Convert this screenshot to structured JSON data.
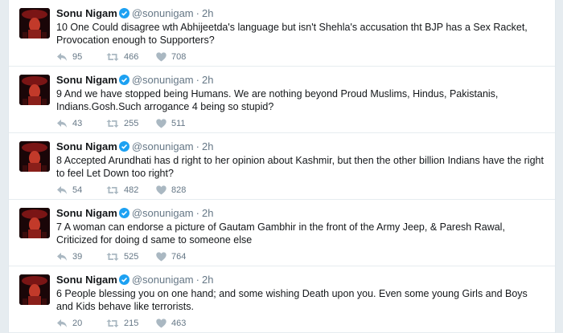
{
  "colors": {
    "verified": "#1da1f2",
    "muted": "#657786",
    "text": "#14171a",
    "background": "#e6ecf0"
  },
  "icons": {
    "reply": "reply-icon",
    "retweet": "retweet-icon",
    "like": "heart-icon",
    "verified": "verified-badge-icon"
  },
  "tweets": [
    {
      "name": "Sonu Nigam",
      "handle": "@sonunigam",
      "separator": "·",
      "time": "2h",
      "text": "10 One Could disagree wth Abhijeetda's language but isn't Shehla's accusation tht BJP has a Sex Racket, Provocation enough to Supporters?",
      "replies": "95",
      "retweets": "466",
      "likes": "708"
    },
    {
      "name": "Sonu Nigam",
      "handle": "@sonunigam",
      "separator": "·",
      "time": "2h",
      "text": "9 And we have stopped being Humans. We are nothing beyond Proud Muslims, Hindus, Pakistanis, Indians.Gosh.Such arrogance 4 being so stupid?",
      "replies": "43",
      "retweets": "255",
      "likes": "511"
    },
    {
      "name": "Sonu Nigam",
      "handle": "@sonunigam",
      "separator": "·",
      "time": "2h",
      "text": "8 Accepted Arundhati has d right to her opinion about Kashmir, but then the other billion Indians have the right to feel Let Down too right?",
      "replies": "54",
      "retweets": "482",
      "likes": "828"
    },
    {
      "name": "Sonu Nigam",
      "handle": "@sonunigam",
      "separator": "·",
      "time": "2h",
      "text": "7 A woman can endorse a picture of Gautam Gambhir in the front of the Army Jeep, & Paresh Rawal, Criticized for doing d same to someone else",
      "replies": "39",
      "retweets": "525",
      "likes": "764"
    },
    {
      "name": "Sonu Nigam",
      "handle": "@sonunigam",
      "separator": "·",
      "time": "2h",
      "text": "6 People blessing you on one hand; and some wishing Death upon you. Even some young Girls and Boys and Kids behave like terrorists.",
      "replies": "20",
      "retweets": "215",
      "likes": "463"
    }
  ]
}
